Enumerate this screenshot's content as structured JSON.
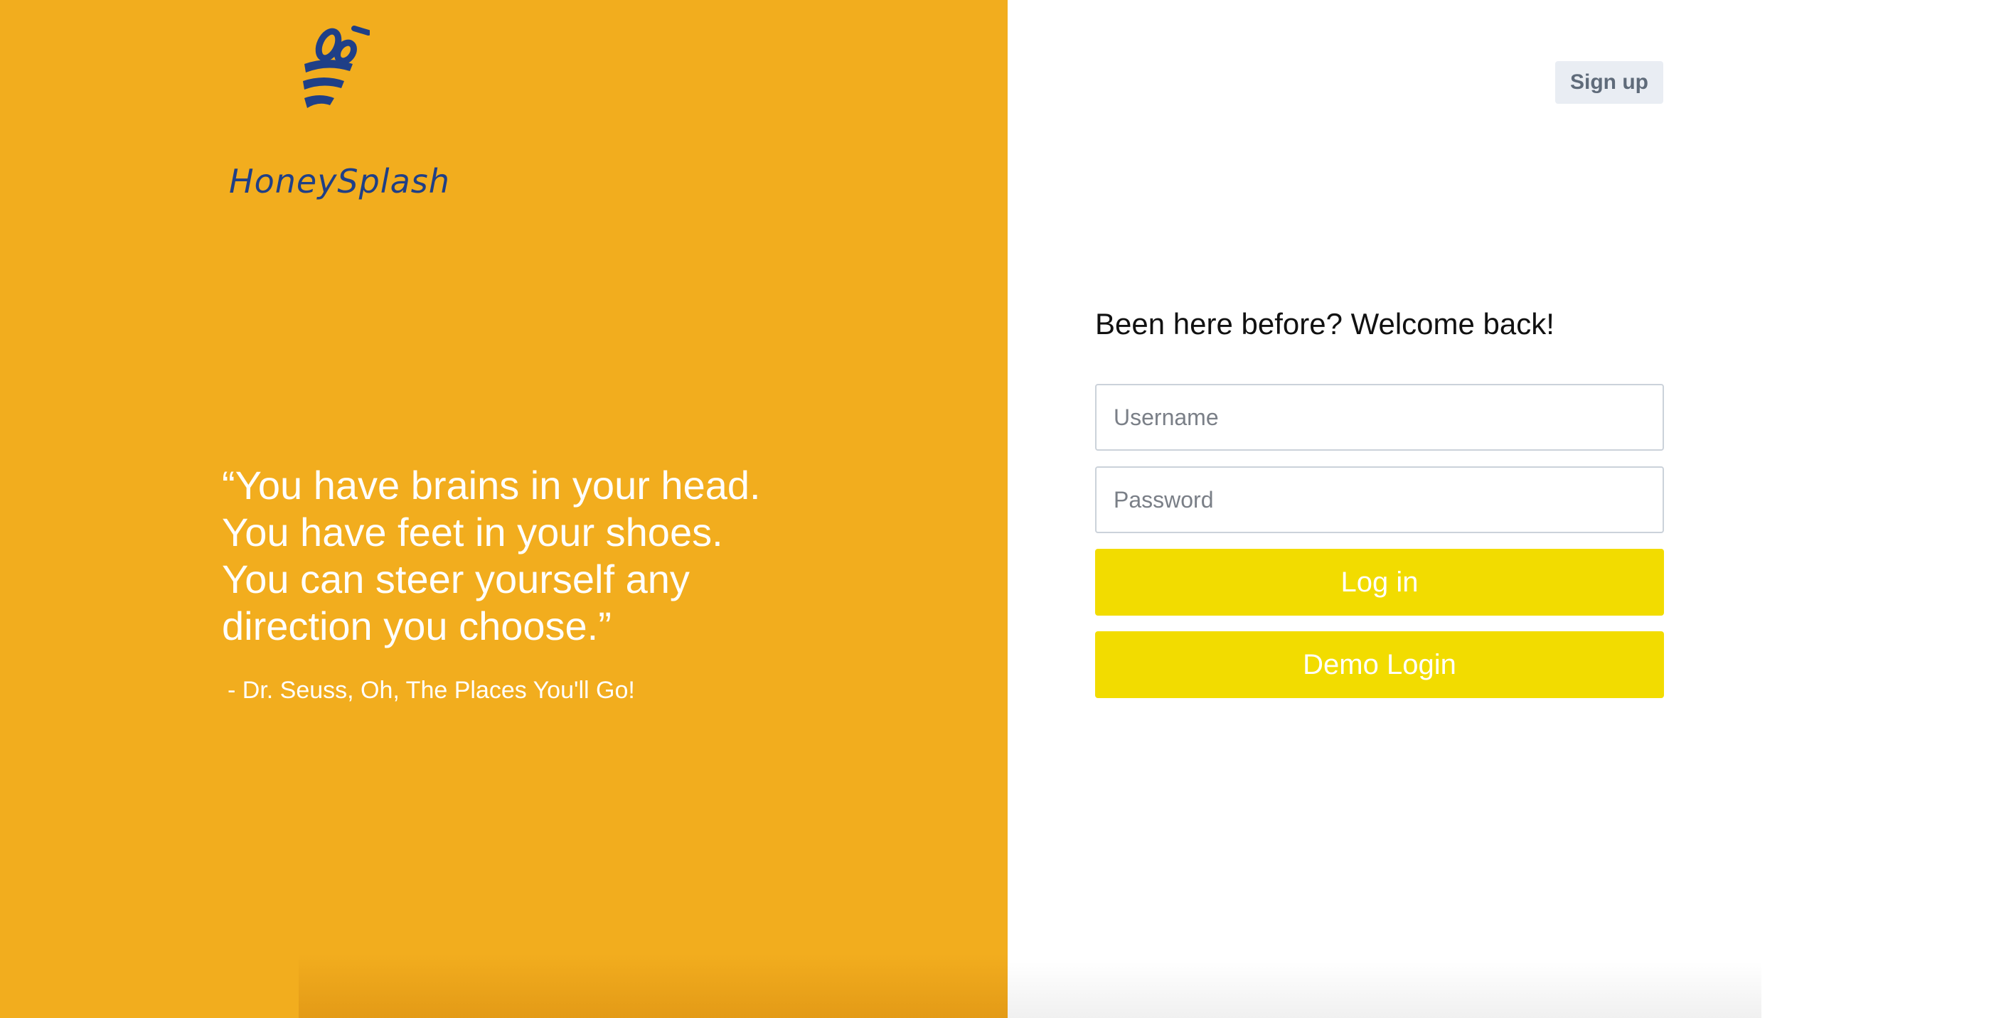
{
  "brand": {
    "name": "HoneySplash",
    "logo_icon": "bee-icon",
    "logo_color": "#1f3f87"
  },
  "colors": {
    "left_panel_bg": "#f2ad1e",
    "button_yellow": "#f2dc00",
    "signup_bg": "#e9edf3"
  },
  "quote": {
    "lines": [
      "“You have brains in your head.",
      "You have feet in your shoes.",
      "You can steer yourself any",
      "direction you choose.”"
    ],
    "attribution": "- Dr. Seuss, Oh, The Places You'll Go!"
  },
  "header": {
    "signup_label": "Sign up"
  },
  "login_form": {
    "heading": "Been here before? Welcome back!",
    "username_placeholder": "Username",
    "password_placeholder": "Password",
    "login_label": "Log in",
    "demo_label": "Demo Login"
  }
}
